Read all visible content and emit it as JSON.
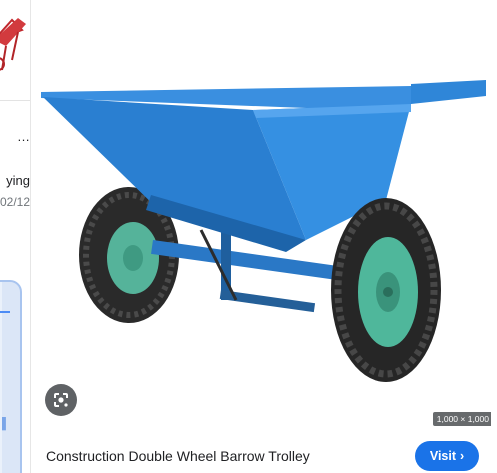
{
  "left_column": {
    "text_line_1": "…",
    "text_line_2": "ying",
    "text_line_3": "02/12"
  },
  "preview": {
    "image_dimensions": "1,000 × 1,000",
    "title": "Construction Double Wheel Barrow Trolley",
    "visit_label": "Visit",
    "lens_icon": "google-lens-icon",
    "visit_icon": "chevron-right-icon"
  },
  "colors": {
    "barrow_blue": "#2f86d8",
    "wheel_green": "#4fb79b",
    "visit_button": "#1a73e8"
  }
}
